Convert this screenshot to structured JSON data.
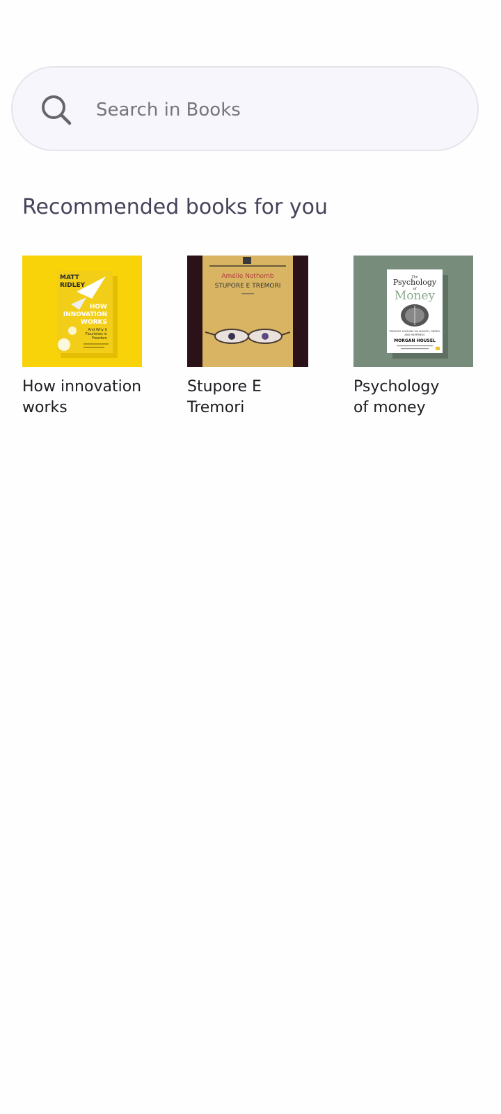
{
  "search": {
    "placeholder": "Search in Books",
    "icon": "search-icon"
  },
  "section": {
    "title": "Recommended books for you"
  },
  "books": [
    {
      "title": "How innovation\nworks",
      "cover": {
        "bg": "#f9d30a",
        "author": [
          "MATT",
          "RIDLEY"
        ],
        "title_lines": [
          "HOW",
          "INNOVATION",
          "WORKS"
        ],
        "subtitle": [
          "And Why It",
          "Flourishes in",
          "Freedom"
        ]
      }
    },
    {
      "title": "Stupore E\nTremori",
      "cover": {
        "bg": "#d9b563",
        "author": "Amélie Nothomb",
        "title_text": "STUPORE E TREMORI"
      }
    },
    {
      "title": "Psychology\nof money",
      "cover": {
        "bg": "#788c7b",
        "title_lines": [
          "The",
          "Psychology",
          "of",
          "Money"
        ],
        "tagline": [
          "TIMELESS LESSONS ON WEALTH, GREED,",
          "AND HAPPINESS"
        ],
        "author": "MORGAN HOUSEL"
      }
    }
  ]
}
